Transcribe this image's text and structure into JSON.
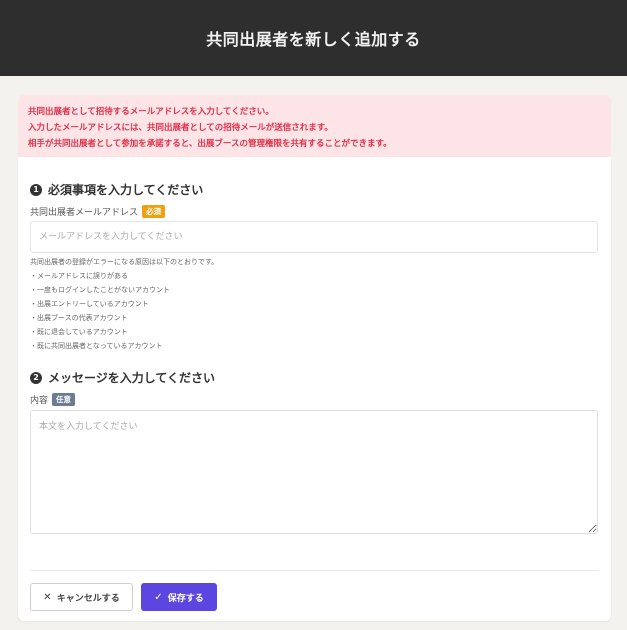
{
  "header": {
    "title": "共同出展者を新しく追加する"
  },
  "notice": {
    "lines": [
      "共同出展者として招待するメールアドレスを入力してください。",
      "入力したメールアドレスには、共同出展者としての招待メールが送信されます。",
      "相手が共同出展者として参加を承諾すると、出展ブースの管理権限を共有することができます。"
    ]
  },
  "section1": {
    "number": "1",
    "title": "必須事項を入力してください",
    "email_label": "共同出展者メールアドレス",
    "required_badge": "必須",
    "email_placeholder": "メールアドレスを入力してください",
    "help_intro": "共同出展者の登録がエラーになる原因は以下のとおりです。",
    "help_items": [
      "・メールアドレスに誤りがある",
      "・一度もログインしたことがないアカウント",
      "・出展エントリーしているアカウント",
      "・出展ブースの代表アカウント",
      "・既に退会しているアカウント",
      "・既に共同出展者となっているアカウント"
    ]
  },
  "section2": {
    "number": "2",
    "title": "メッセージを入力してください",
    "content_label": "内容",
    "optional_badge": "任意",
    "content_placeholder": "本文を入力してください"
  },
  "actions": {
    "cancel_label": "キャンセルする",
    "save_label": "保存する",
    "cancel_icon": "close-icon",
    "save_icon": "check-icon"
  },
  "colors": {
    "header_bg": "#2e2e2e",
    "notice_bg": "#fde4e6",
    "notice_text": "#e0314a",
    "primary": "#5b47e0",
    "required_badge": "#f0a015",
    "optional_badge": "#6b7c93"
  }
}
